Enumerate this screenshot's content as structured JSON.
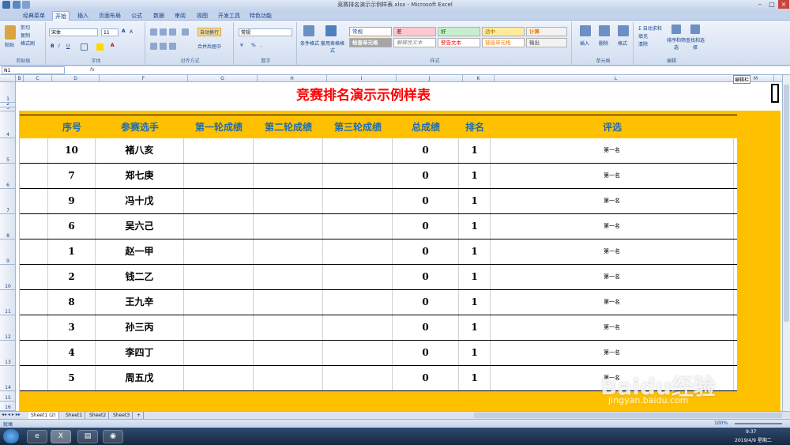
{
  "window": {
    "title": "竞赛排名演示示例样表.xlsx - Microsoft Excel"
  },
  "tabs": [
    "经典菜单",
    "开始",
    "插入",
    "页面布局",
    "公式",
    "数据",
    "审阅",
    "视图",
    "开发工具",
    "特色功能"
  ],
  "ribbon": {
    "clipboard": {
      "paste": "粘贴",
      "cut": "剪切",
      "copy": "复制",
      "format_painter": "格式刷",
      "label": "剪贴板"
    },
    "font": {
      "name": "宋体",
      "size": "11",
      "label": "字体"
    },
    "align": {
      "wrap": "自动换行",
      "merge": "合并后居中",
      "label": "对齐方式"
    },
    "number": {
      "format": "常规",
      "label": "数字"
    },
    "styles": {
      "conditional": "条件格式",
      "table": "套用表格格式",
      "cells": [
        "常规",
        "差",
        "好",
        "适中",
        "计算",
        "检查单元格",
        "解释性文本",
        "警告文本",
        "链接单元格",
        "输出"
      ],
      "label": "样式"
    },
    "cells": {
      "insert": "插入",
      "delete": "删除",
      "format": "格式",
      "label": "单元格"
    },
    "editing": {
      "autosum": "自动求和",
      "fill": "填充",
      "clear": "清除",
      "sort": "排序和筛选",
      "find": "查找和选择",
      "label": "编辑"
    }
  },
  "formula_bar": {
    "name_box": "N1",
    "fx": "fx",
    "content": ""
  },
  "editbar_tip": "编辑栏",
  "column_headers": [
    "B",
    "C",
    "D",
    "E",
    "F",
    "G",
    "H",
    "I",
    "J",
    "K",
    "L",
    "M"
  ],
  "row_headers": [
    "1",
    "2",
    "3",
    "4",
    "5",
    "6",
    "7",
    "8",
    "9",
    "10",
    "11",
    "12",
    "13",
    "14",
    "15",
    "16"
  ],
  "sheet": {
    "title": "竞赛排名演示示例样表",
    "headers": [
      "序号",
      "参赛选手",
      "第一轮成绩",
      "第二轮成绩",
      "第三轮成绩",
      "总成绩",
      "排名",
      "评选"
    ],
    "rows": [
      {
        "no": "10",
        "name": "褚八亥",
        "r1": "",
        "r2": "",
        "r3": "",
        "total": "0",
        "rank": "1",
        "award": "第一名"
      },
      {
        "no": "7",
        "name": "郑七庚",
        "r1": "",
        "r2": "",
        "r3": "",
        "total": "0",
        "rank": "1",
        "award": "第一名"
      },
      {
        "no": "9",
        "name": "冯十戊",
        "r1": "",
        "r2": "",
        "r3": "",
        "total": "0",
        "rank": "1",
        "award": "第一名"
      },
      {
        "no": "6",
        "name": "吴六己",
        "r1": "",
        "r2": "",
        "r3": "",
        "total": "0",
        "rank": "1",
        "award": "第一名"
      },
      {
        "no": "1",
        "name": "赵一甲",
        "r1": "",
        "r2": "",
        "r3": "",
        "total": "0",
        "rank": "1",
        "award": "第一名"
      },
      {
        "no": "2",
        "name": "钱二乙",
        "r1": "",
        "r2": "",
        "r3": "",
        "total": "0",
        "rank": "1",
        "award": "第一名"
      },
      {
        "no": "8",
        "name": "王九辛",
        "r1": "",
        "r2": "",
        "r3": "",
        "total": "0",
        "rank": "1",
        "award": "第一名"
      },
      {
        "no": "3",
        "name": "孙三丙",
        "r1": "",
        "r2": "",
        "r3": "",
        "total": "0",
        "rank": "1",
        "award": "第一名"
      },
      {
        "no": "4",
        "name": "李四丁",
        "r1": "",
        "r2": "",
        "r3": "",
        "total": "0",
        "rank": "1",
        "award": "第一名"
      },
      {
        "no": "5",
        "name": "周五戊",
        "r1": "",
        "r2": "",
        "r3": "",
        "total": "0",
        "rank": "1",
        "award": "第一名"
      }
    ]
  },
  "sheet_tabs": [
    "Sheet1 (2)",
    "Sheet1",
    "Sheet2",
    "Sheet3"
  ],
  "status": {
    "ready": "就绪",
    "zoom": "100%"
  },
  "taskbar": {
    "time": "9:37",
    "date": "2019/4/9 星期二"
  },
  "watermark": {
    "brand": "Baidu经验",
    "url": "jingyan.baidu.com"
  },
  "colors": {
    "accent_orange": "#ffc000",
    "title_red": "#ff0000",
    "header_blue": "#1f6db0"
  }
}
